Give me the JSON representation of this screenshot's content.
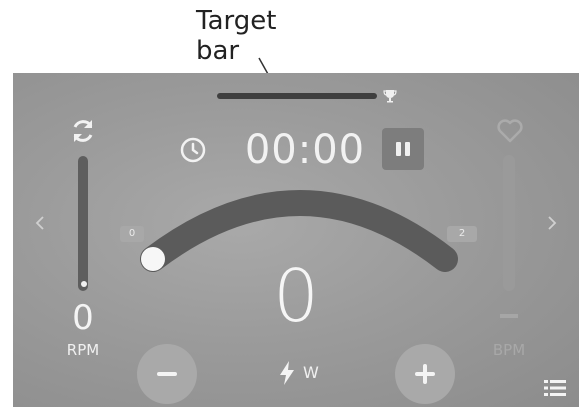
{
  "annotation": {
    "line1": "Target",
    "line2": "bar"
  },
  "timer": {
    "value": "00:00"
  },
  "rpm": {
    "value": "0",
    "label": "RPM"
  },
  "bpm": {
    "label": "BPM"
  },
  "level": {
    "min": "0",
    "max": "2",
    "position": 0.0
  },
  "power": {
    "value": "0",
    "unit": "W"
  },
  "target_bar": {
    "fill": 0.0
  },
  "icons": {
    "sync": "sync-icon",
    "clock": "clock-icon",
    "pause": "pause-icon",
    "trophy": "trophy-icon",
    "heart": "heart-icon",
    "bolt": "bolt-icon",
    "minus": "minus-icon",
    "plus": "plus-icon",
    "menu": "list-menu-icon",
    "left": "chevron-left-icon",
    "right": "chevron-right-icon"
  },
  "colors": {
    "screen_bg": "#9b9b9b",
    "arc": "#5a5a5a",
    "text": "#f2f2f2",
    "button": "#a9a9a9"
  }
}
